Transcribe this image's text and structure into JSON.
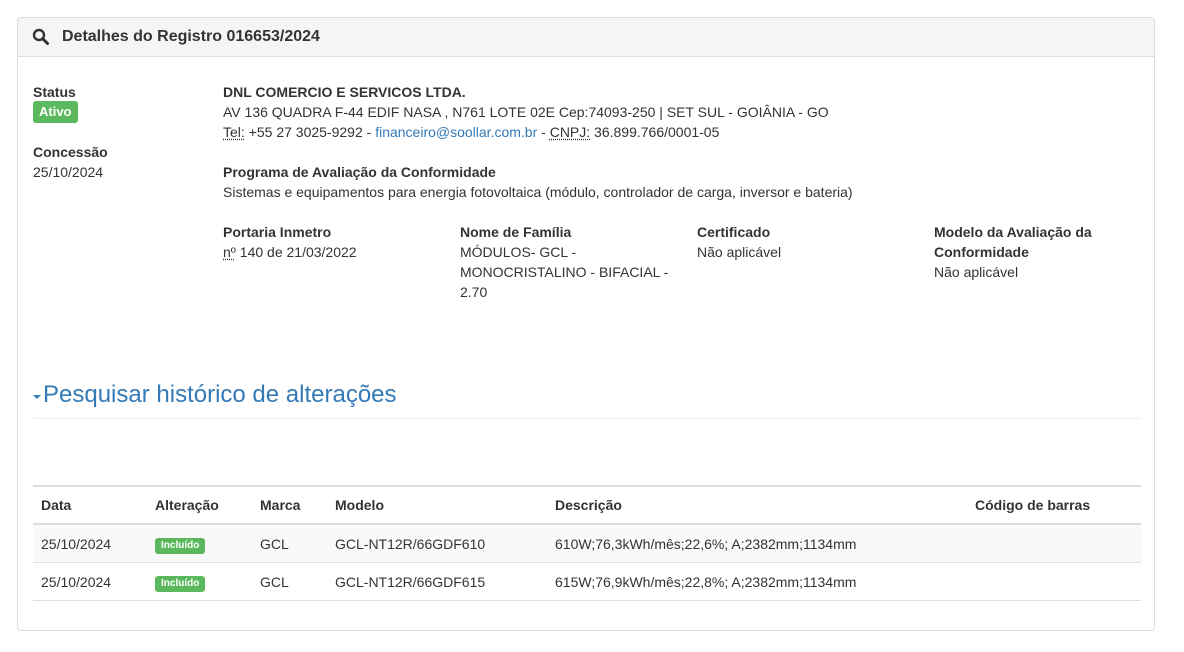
{
  "header": {
    "title": "Detalhes do Registro 016653/2024",
    "icon": "search-icon"
  },
  "status": {
    "label": "Status",
    "value": "Ativo",
    "color": "#5cb85c"
  },
  "concessao": {
    "label": "Concessão",
    "value": "25/10/2024"
  },
  "company": {
    "name": "DNL COMERCIO E SERVICOS LTDA.",
    "address": "AV 136 QUADRA F-44 EDIF NASA , N761 LOTE 02E Cep:74093-250 | SET SUL - GOIÂNIA - GO",
    "tel_label": "Tel:",
    "tel_value": " +55 27 3025-9292 - ",
    "email": "financeiro@soollar.com.br",
    "sep": " - ",
    "cnpj_label": "CNPJ:",
    "cnpj_value": " 36.899.766/0001-05"
  },
  "programa": {
    "label": "Programa de Avaliação da Conformidade",
    "value": "Sistemas e equipamentos para energia fotovoltaica (módulo, controlador de carga, inversor e bateria)"
  },
  "portaria": {
    "label": "Portaria Inmetro",
    "num_abbr": "nº",
    "value": " 140 de 21/03/2022"
  },
  "familia": {
    "label": "Nome de Família",
    "value": "MÓDULOS- GCL - MONOCRISTALINO - BIFACIAL - 2.70"
  },
  "certificado": {
    "label": "Certificado",
    "value": "Não aplicável"
  },
  "modelo_avaliacao": {
    "label": "Modelo da Avaliação da Conformidade",
    "value": "Não aplicável"
  },
  "historico": {
    "link_label": "Pesquisar histórico de alterações"
  },
  "table": {
    "headers": [
      "Data",
      "Alteração",
      "Marca",
      "Modelo",
      "Descrição",
      "Código de barras"
    ],
    "rows": [
      {
        "data": "25/10/2024",
        "alteracao": "Incluído",
        "marca": "GCL",
        "modelo": "GCL-NT12R/66GDF610",
        "descricao": "610W;76,3kWh/mês;22,6%; A;2382mm;1134mm",
        "codigo": ""
      },
      {
        "data": "25/10/2024",
        "alteracao": "Incluído",
        "marca": "GCL",
        "modelo": "GCL-NT12R/66GDF615",
        "descricao": "615W;76,9kWh/mês;22,8%; A;2382mm;1134mm",
        "codigo": ""
      }
    ]
  }
}
